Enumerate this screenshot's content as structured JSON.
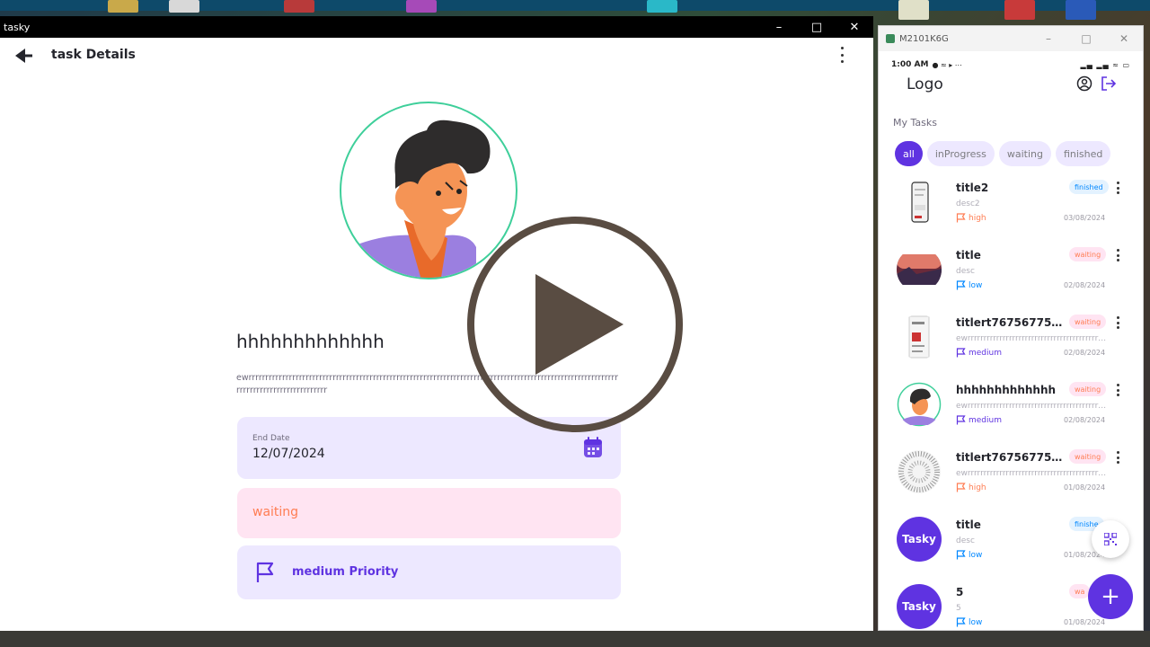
{
  "window": {
    "title": "tasky"
  },
  "details": {
    "header_title": "task Details",
    "task_title": "hhhhhhhhhhhhh",
    "task_description": "ewrrrrrrrrrrrrrrrrrrrrrrrrrrrrrrrrrrrrrrrrrrrrrrrrrrrrrrrrrrrrrrrrrrrrrrrrrrrrrrrrrrrrrrrrrrrrrrrrrrrrrrrrrrrrrrrrrrrrrrrrrrrrrrrrrrrrrrrrr",
    "end_date_label": "End Date",
    "end_date_value": "12/07/2024",
    "status": "waiting",
    "priority": "medium Priority"
  },
  "phone": {
    "device_name": "M2101K6G",
    "status_time": "1:00 AM",
    "logo": "Logo",
    "section_title": "My Tasks",
    "filters": [
      {
        "label": "all",
        "active": true
      },
      {
        "label": "inProgress",
        "active": false
      },
      {
        "label": "waiting",
        "active": false
      },
      {
        "label": "finished",
        "active": false
      }
    ],
    "tasks": [
      {
        "title": "title2",
        "desc": "desc2",
        "priority": "high",
        "date": "03/08/2024",
        "status": "finished",
        "thumb": "phone"
      },
      {
        "title": "title",
        "desc": "desc",
        "priority": "low",
        "date": "02/08/2024",
        "status": "waiting",
        "thumb": "landscape"
      },
      {
        "title": "titlert767567756rrr...",
        "desc": "ewrrrrrrrrrrrrrrrrrrrrrrrrrrrrrrrrrrrrrrrrrrrr...",
        "priority": "medium",
        "date": "02/08/2024",
        "status": "waiting",
        "thumb": "poster"
      },
      {
        "title": "hhhhhhhhhhhhh",
        "desc": "ewrrrrrrrrrrrrrrrrrrrrrrrrrrrrrrrrrrrrrrrrrrrrr...",
        "priority": "medium",
        "date": "02/08/2024",
        "status": "waiting",
        "thumb": "avatar"
      },
      {
        "title": "titlert767567756rrr...",
        "desc": "ewrrrrrrrrrrrrrrrrrrrrrrrrrrrrrrrrrrrrrrrrrrrr...",
        "priority": "high",
        "date": "01/08/2024",
        "status": "waiting",
        "thumb": "noise"
      },
      {
        "title": "title",
        "desc": "desc",
        "priority": "low",
        "date": "01/08/2024",
        "status": "finishe",
        "thumb": "tasky",
        "thumb_text": "Tasky"
      },
      {
        "title": "5",
        "desc": "5",
        "priority": "low",
        "date": "01/08/2024",
        "status": "wa",
        "thumb": "tasky",
        "thumb_text": "Tasky"
      }
    ],
    "fab_add": "+"
  },
  "colors": {
    "accent": "#5f33e1",
    "waiting": "#ff7d53",
    "finished": "#0087ff",
    "high": "#ff7d53",
    "medium": "#5f33e1",
    "low": "#0087ff"
  }
}
